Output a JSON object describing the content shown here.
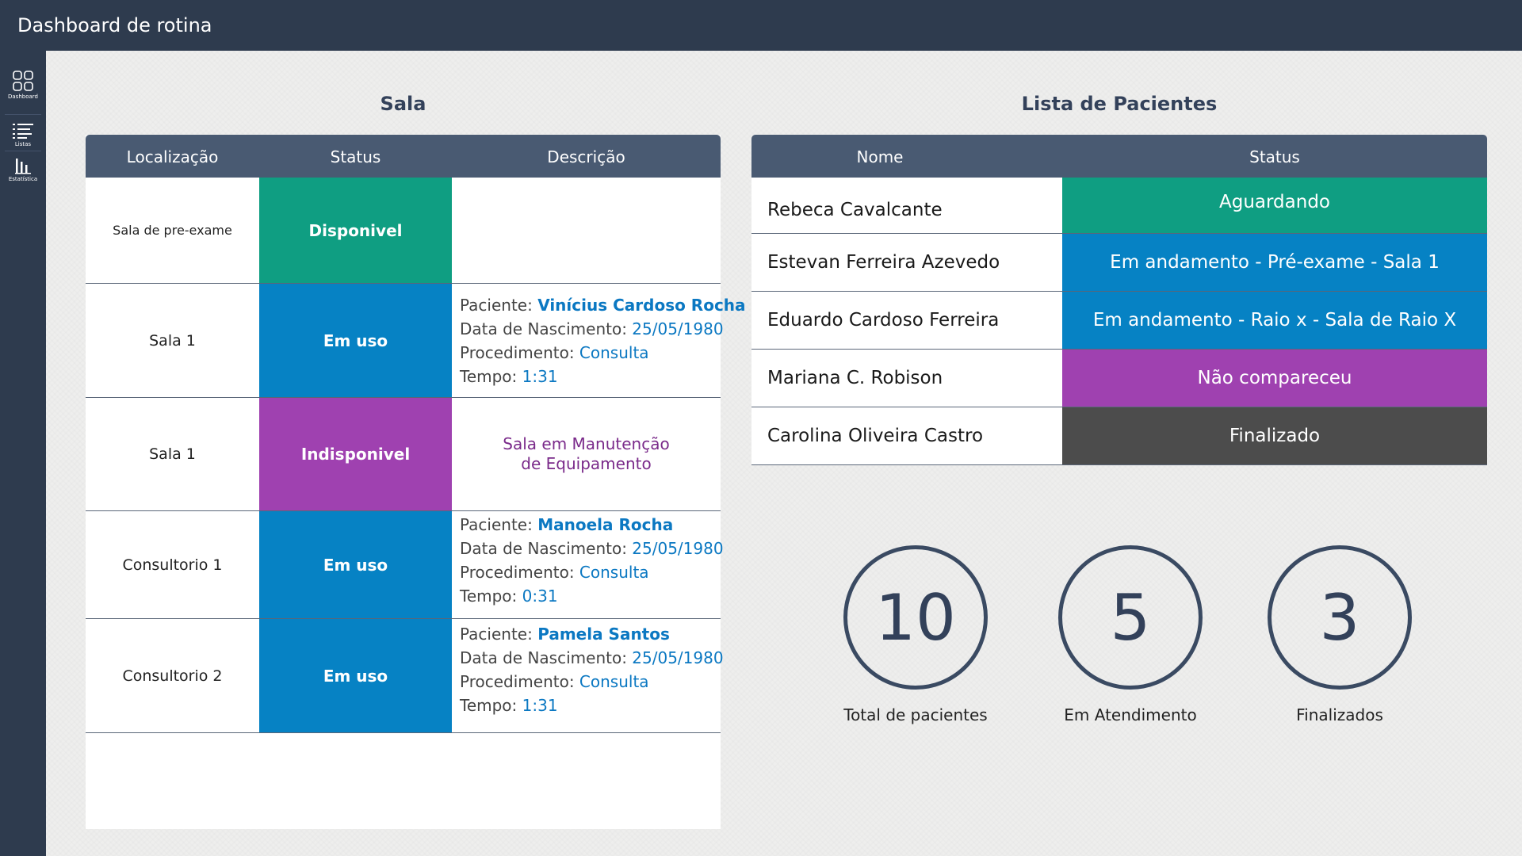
{
  "app": {
    "title": "Dashboard de rotina"
  },
  "sidebar": {
    "items": [
      {
        "label": "Dashboard",
        "icon": "grid-icon"
      },
      {
        "label": "Listas",
        "icon": "list-icon"
      },
      {
        "label": "Estatística",
        "icon": "bar-chart-icon"
      }
    ]
  },
  "sala": {
    "title": "Sala",
    "columns": [
      "Localização",
      "Status",
      "Descrição"
    ],
    "rows": [
      {
        "location": "Sala de pre-exame",
        "status": "Disponivel",
        "status_color": "#0f9e82"
      },
      {
        "location": "Sala 1",
        "status": "Em uso",
        "status_color": "#0682c4",
        "desc": {
          "patient_label": "Paciente:",
          "patient": "Vinícius Cardoso Rocha",
          "dob_label": "Data de Nascimento:",
          "dob": "25/05/1980",
          "proc_label": "Procedimento:",
          "proc": "Consulta",
          "time_label": "Tempo:",
          "time": "1:31"
        }
      },
      {
        "location": "Sala 1",
        "status": "Indisponivel",
        "status_color": "#9f41b0",
        "note_line1": "Sala em Manutenção",
        "note_line2": "de Equipamento"
      },
      {
        "location": "Consultorio 1",
        "status": "Em uso",
        "status_color": "#0682c4",
        "desc": {
          "patient_label": "Paciente:",
          "patient": "Manoela Rocha",
          "dob_label": "Data de Nascimento:",
          "dob": "25/05/1980",
          "proc_label": "Procedimento:",
          "proc": "Consulta",
          "time_label": "Tempo:",
          "time": "0:31"
        }
      },
      {
        "location": "Consultorio 2",
        "status": "Em uso",
        "status_color": "#0682c4",
        "desc": {
          "patient_label": "Paciente:",
          "patient": "Pamela Santos",
          "dob_label": "Data de Nascimento:",
          "dob": "25/05/1980",
          "proc_label": "Procedimento:",
          "proc": "Consulta",
          "time_label": "Tempo:",
          "time": "1:31"
        }
      }
    ]
  },
  "pacientes": {
    "title": "Lista de Pacientes",
    "columns": [
      "Nome",
      "Status"
    ],
    "rows": [
      {
        "name": "Rebeca Cavalcante",
        "status": "Aguardando",
        "status_color": "#0f9e82"
      },
      {
        "name": "Estevan Ferreira Azevedo",
        "status": "Em andamento - Pré-exame - Sala 1",
        "status_color": "#0682c4"
      },
      {
        "name": "Eduardo Cardoso Ferreira",
        "status": "Em andamento - Raio x - Sala de Raio X",
        "status_color": "#0682c4"
      },
      {
        "name": "Mariana C. Robison",
        "status": "Não compareceu",
        "status_color": "#9f41b0"
      },
      {
        "name": "Carolina Oliveira Castro",
        "status": "Finalizado",
        "status_color": "#4c4c4c"
      }
    ]
  },
  "stats": [
    {
      "value": "10",
      "label": "Total de pacientes"
    },
    {
      "value": "5",
      "label": "Em Atendimento"
    },
    {
      "value": "3",
      "label": "Finalizados"
    }
  ]
}
